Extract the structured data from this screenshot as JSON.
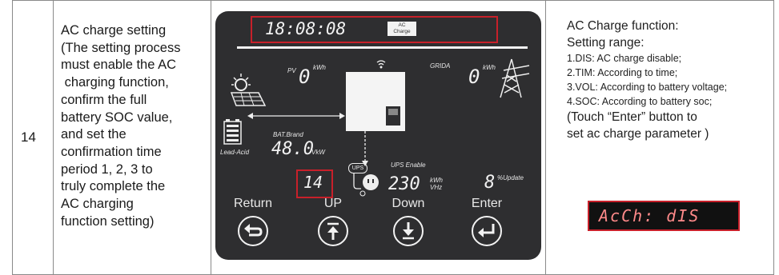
{
  "row": {
    "number": "14",
    "description_lines": [
      "AC charge setting",
      "(The setting process",
      "must enable the AC",
      " charging function,",
      "confirm the full",
      "battery SOC value,",
      "and set the",
      "confirmation time",
      "period 1, 2, 3 to",
      "truly complete the",
      "AC charging",
      "function setting)"
    ]
  },
  "panel": {
    "time": "18:08:08",
    "mode_badge_line1": "AC",
    "mode_badge_line2": "Charge",
    "pv_label": "PV",
    "pv_value": "0",
    "pv_unit": "kWh",
    "grid_label": "GRIDA",
    "grid_value": "0",
    "grid_unit": "kWh",
    "battery_brand_label": "BAT.Brand",
    "battery_type": "Lead-Acid",
    "battery_value": "48.0",
    "battery_unit": "VkW",
    "ups_enable_label": "UPS Enable",
    "ups_badge": "UPS",
    "setting_code": "14",
    "output_value": "230",
    "output_unit_1": "kWh",
    "output_unit_2": "VHz",
    "update_value": "8",
    "update_label": "%Update",
    "buttons": {
      "return": "Return",
      "up": "UP",
      "down": "Down",
      "enter": "Enter"
    }
  },
  "info": {
    "title": "AC Charge function:",
    "range_label": "Setting range:",
    "options": [
      "1.DIS: AC charge disable;",
      "2.TIM: According to time;",
      "3.VOL: According to battery voltage;",
      "4.SOC: According to battery soc;"
    ],
    "touch_note_1": "(Touch “Enter” button to",
    "touch_note_2": "set ac charge parameter )",
    "display_text": "AcCh: dIS"
  },
  "colors": {
    "panel_bg": "#2e2e30",
    "highlight_red": "#c8202a",
    "display_text": "#ff8a8a"
  }
}
